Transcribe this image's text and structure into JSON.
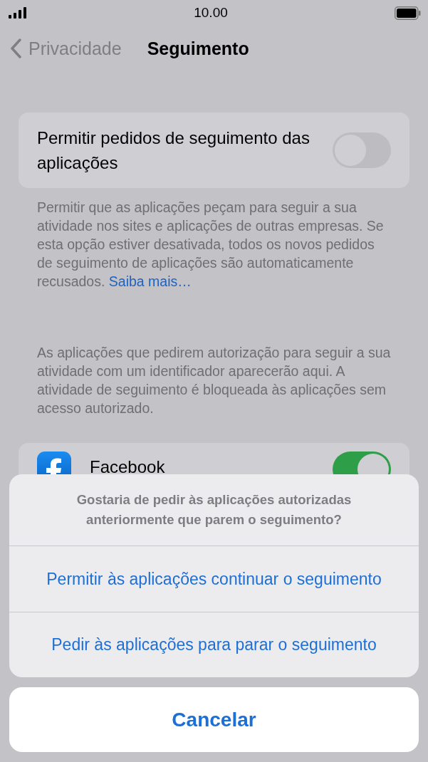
{
  "status_bar": {
    "time": "10.00"
  },
  "nav": {
    "back": "Privacidade",
    "title": "Seguimento"
  },
  "tracking_toggle": {
    "label": "Permitir pedidos de seguimento das aplicações",
    "on": false
  },
  "tracking_footer": {
    "text": "Permitir que as aplicações peçam para seguir a sua atividade nos sites e aplicações de outras empresas. Se esta opção estiver desativada, todos os novos pedidos de seguimento de aplicações são automaticamente recusados.",
    "link": "Saiba mais…"
  },
  "apps_header": "As aplicações que pedirem autorização para seguir a sua atividade com um identificador aparecerão aqui. A atividade de seguimento é bloqueada às aplicações sem acesso autorizado.",
  "apps": [
    {
      "name": "Facebook",
      "on": true
    }
  ],
  "action_sheet": {
    "message": "Gostaria de pedir às aplicações autorizadas anteriormente que parem o seguimento?",
    "actions": [
      "Permitir às aplicações continuar o seguimento",
      "Pedir às aplicações para parar o seguimento"
    ],
    "cancel": "Cancelar"
  }
}
